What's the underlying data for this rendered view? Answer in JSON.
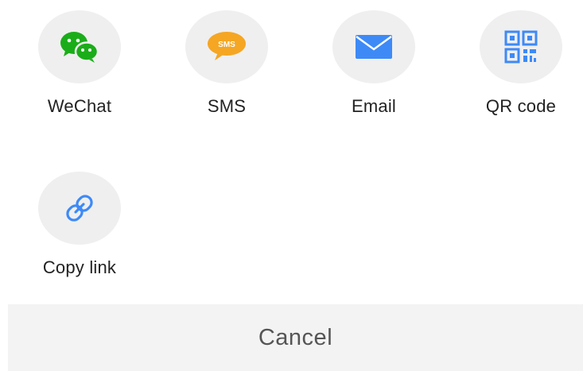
{
  "share_sheet": {
    "items": [
      {
        "id": "wechat",
        "label": "WeChat",
        "icon": "wechat-icon",
        "color": "#1aad19"
      },
      {
        "id": "sms",
        "label": "SMS",
        "icon": "sms-bubble-icon",
        "color": "#f5a623",
        "icon_text": "SMS"
      },
      {
        "id": "email",
        "label": "Email",
        "icon": "envelope-icon",
        "color": "#3d8af7"
      },
      {
        "id": "qr",
        "label": "QR code",
        "icon": "qr-code-icon",
        "color": "#3d8af7"
      },
      {
        "id": "copy",
        "label": "Copy link",
        "icon": "link-icon",
        "color": "#3d8af7"
      }
    ],
    "cancel_label": "Cancel"
  },
  "colors": {
    "icon_background": "#efefef",
    "cancel_background": "#f3f3f3",
    "label_text": "#222222",
    "cancel_text": "#555555"
  }
}
